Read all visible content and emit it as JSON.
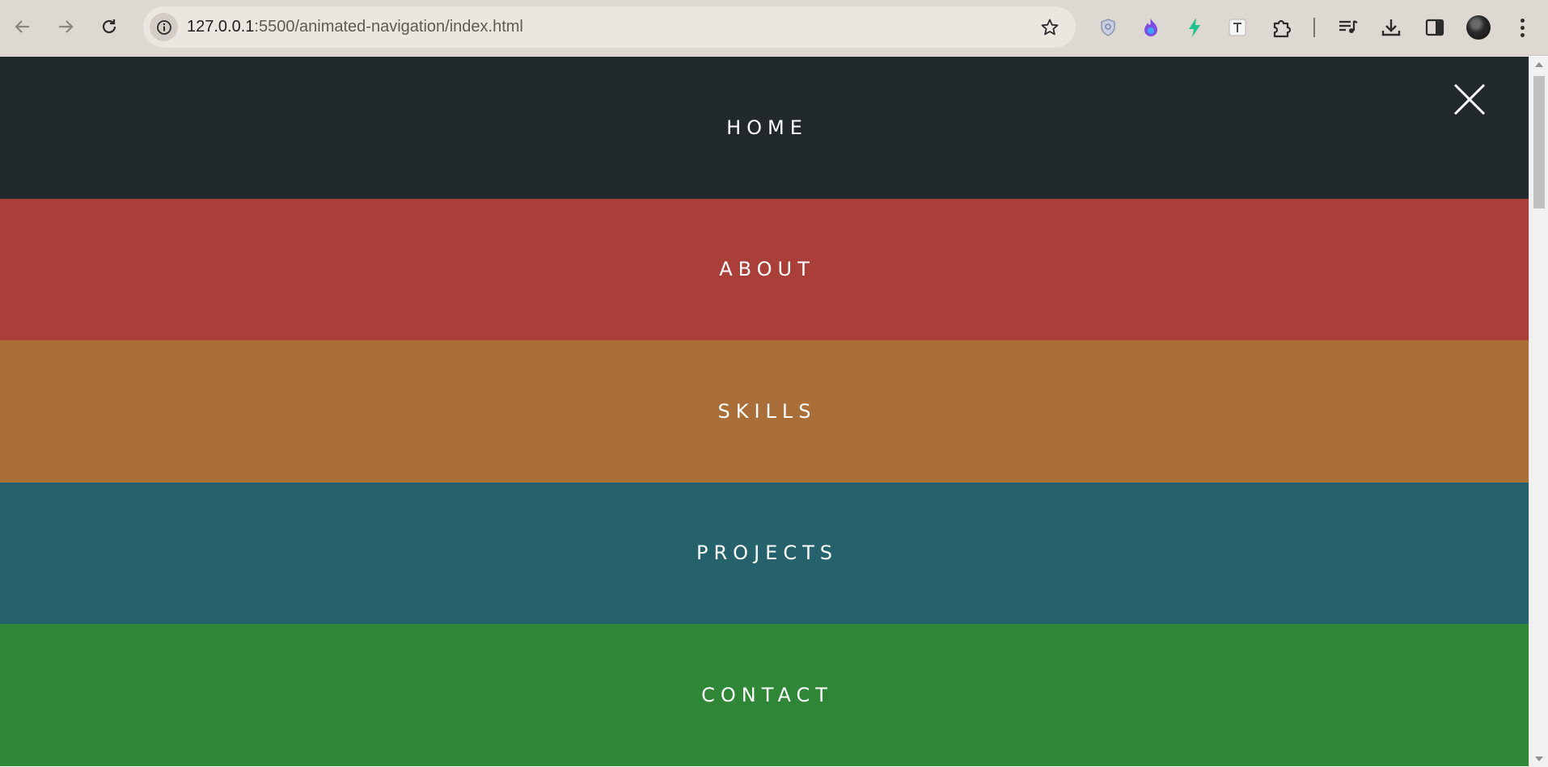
{
  "browser": {
    "url_host": "127.0.0.1",
    "url_rest": ":5500/animated-navigation/index.html",
    "colors": {
      "toolbar": "#ddd8d2",
      "omnibox": "#ebe6e0"
    },
    "icons": {
      "back": "arrow-left-icon",
      "forward": "arrow-right-icon",
      "reload": "reload-icon",
      "site_info": "info-icon",
      "bookmark": "star-icon",
      "extensions": [
        "shield-extension-icon",
        "flame-extension-icon",
        "bolt-extension-icon",
        "text-extension-icon",
        "puzzle-icon"
      ],
      "media": "media-queue-icon",
      "downloads": "download-icon",
      "side_panel": "side-panel-icon",
      "profile": "avatar",
      "menu": "kebab-menu-icon"
    }
  },
  "page": {
    "nav_items": [
      {
        "label": "HOME",
        "color": "#21292c"
      },
      {
        "label": "ABOUT",
        "color": "#aa3e39"
      },
      {
        "label": "SKILLS",
        "color": "#aa6e38"
      },
      {
        "label": "PROJECTS",
        "color": "#25626b"
      },
      {
        "label": "CONTACT",
        "color": "#2e8636"
      }
    ],
    "close_icon": "close-icon",
    "text_color": "#ffffff"
  }
}
